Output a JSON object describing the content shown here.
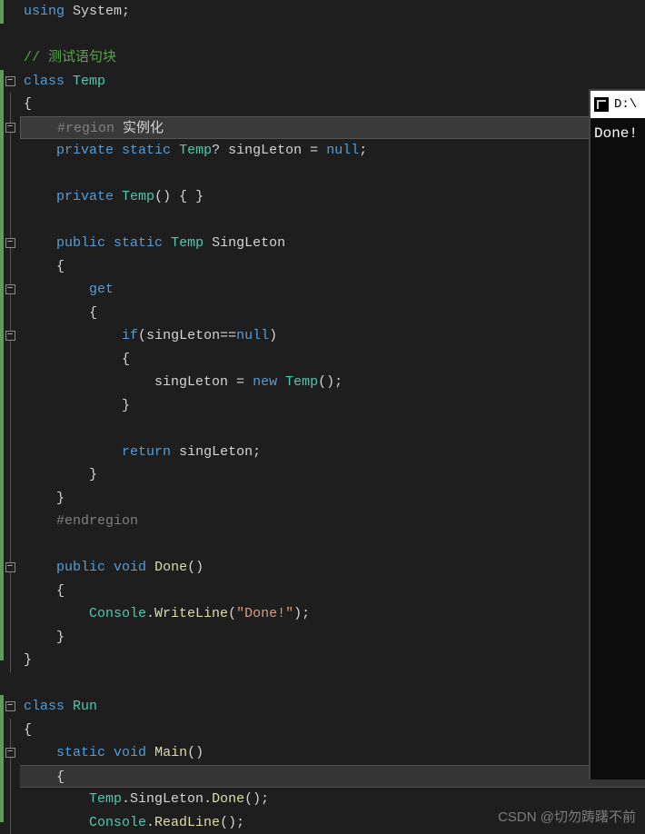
{
  "code": {
    "line1_using": "using",
    "line1_ns": "System",
    "line1_semi": ";",
    "comment_test": "// 测试语句块",
    "kw_class": "class",
    "class_temp": "Temp",
    "brace_open": "{",
    "brace_close": "}",
    "region_start": "#region",
    "region_label": "实例化",
    "kw_private": "private",
    "kw_static": "static",
    "kw_public": "public",
    "kw_void": "void",
    "type_temp_q": "Temp",
    "qmark": "?",
    "field_singLeton": "singLeton",
    "eq": "=",
    "kw_null": "null",
    "semi": ";",
    "ctor_parens": "() { }",
    "prop_SingLeton": "SingLeton",
    "kw_get": "get",
    "kw_if": "if",
    "if_cond_open": "(",
    "if_cond_eq": "==",
    "if_cond_close": ")",
    "kw_new": "new",
    "new_parens": "();",
    "kw_return": "return",
    "endregion": "#endregion",
    "method_Done": "Done",
    "done_parens": "()",
    "class_Console": "Console",
    "dot": ".",
    "method_WriteLine": "WriteLine",
    "str_done": "\"Done!\"",
    "writeline_close": ");",
    "class_Run": "Run",
    "method_Main": "Main",
    "method_ReadLine": "ReadLine",
    "call_close": "();"
  },
  "console": {
    "title_path": "D:\\",
    "output": "Done!"
  },
  "watermark": "CSDN @切勿踌躇不前"
}
